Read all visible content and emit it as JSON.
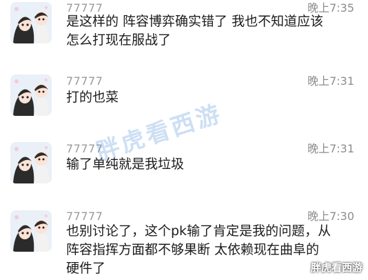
{
  "messages": [
    {
      "sender": "77777",
      "time": "晚上7:35",
      "lines": [
        "是这样的 阵容博弈确实错了 我也不知道应该",
        "怎么打现在服战了"
      ]
    },
    {
      "sender": "77777",
      "time": "晚上7:31",
      "lines": [
        "打的也菜"
      ]
    },
    {
      "sender": "77777",
      "time": "晚上7:31",
      "lines": [
        "输了单纯就是我垃圾"
      ]
    },
    {
      "sender": "77777",
      "time": "晚上7:30",
      "lines": [
        "也别讨论了，这个pk输了肯定是我的问题，从",
        "阵容指挥方面都不够果断 太依赖现在曲阜的",
        "硬件了"
      ]
    }
  ],
  "watermark": {
    "center": "胖虎看西游",
    "corner": "胖虎看西游"
  },
  "colors": {
    "background": "#ffffff",
    "text": "#1b1b1b",
    "meta": "#9a9a9a"
  }
}
